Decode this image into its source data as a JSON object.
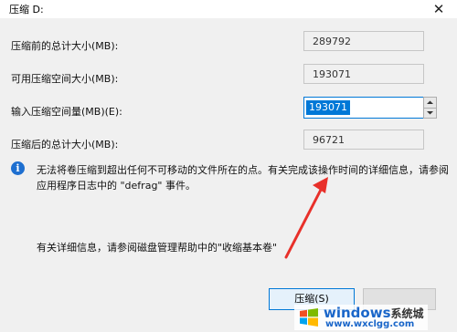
{
  "window": {
    "title": "压缩 D:",
    "close_glyph": "✕"
  },
  "fields": {
    "total_before_label": "压缩前的总计大小(MB):",
    "total_before_value": "289792",
    "available_label": "可用压缩空间大小(MB):",
    "available_value": "193071",
    "amount_label": "输入压缩空间量(MB)(E):",
    "amount_value": "193071",
    "total_after_label": "压缩后的总计大小(MB):",
    "total_after_value": "96721"
  },
  "info": {
    "icon_glyph": "i",
    "message": "无法将卷压缩到超出任何不可移动的文件所在的点。有关完成该操作时间的详细信息，请参阅应用程序日志中的 \"defrag\" 事件。",
    "more_info": "有关详细信息，请参阅磁盘管理帮助中的\"收缩基本卷\""
  },
  "buttons": {
    "compress_label": "压缩(S)",
    "cancel_label": ""
  },
  "watermark": {
    "brand": "windows",
    "brand_suffix": "系统城",
    "site": "www.wxclgg.com",
    "logo_icon": "windows-logo-icon"
  },
  "colors": {
    "accent": "#0078d7",
    "arrow": "#e8302a",
    "info_icon": "#1e6fd0"
  }
}
